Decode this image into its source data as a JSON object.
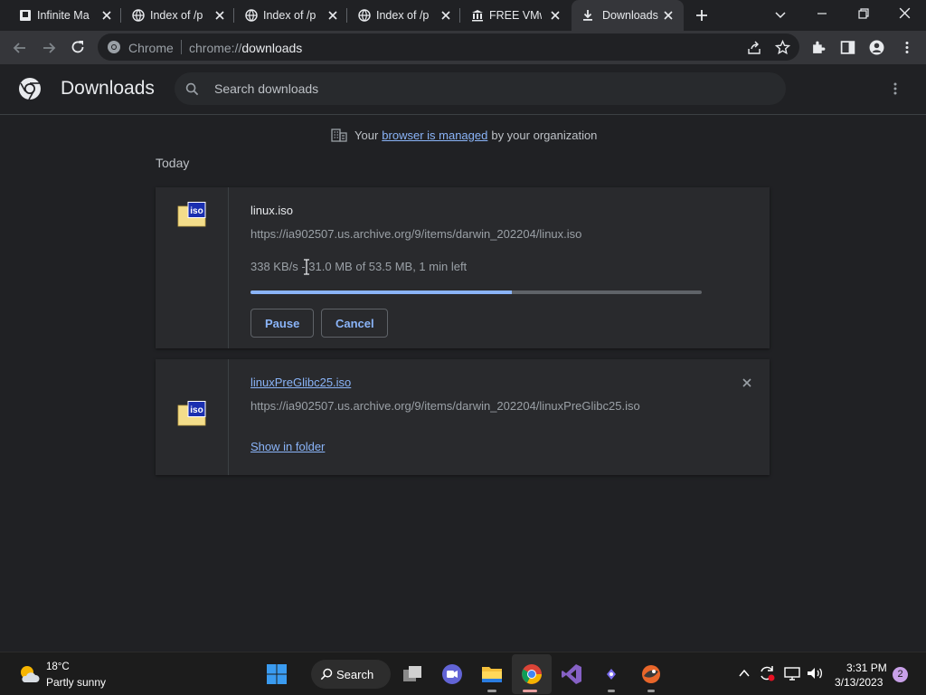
{
  "tabs": [
    {
      "title": "Infinite Mac",
      "favicon": "document-icon"
    },
    {
      "title": "Index of /pub",
      "favicon": "globe-icon"
    },
    {
      "title": "Index of /pub",
      "favicon": "globe-icon"
    },
    {
      "title": "Index of /pub",
      "favicon": "globe-icon"
    },
    {
      "title": "FREE VMware",
      "favicon": "archive-icon"
    },
    {
      "title": "Downloads",
      "favicon": "download-icon"
    }
  ],
  "omnibox": {
    "chip": "Chrome",
    "url_prefix": "chrome://",
    "url_path": "downloads"
  },
  "header": {
    "title": "Downloads",
    "search_placeholder": "Search downloads"
  },
  "managed": {
    "before": "Your",
    "link": "browser is managed",
    "after": "by your organization"
  },
  "section_label": "Today",
  "downloads": [
    {
      "filename": "linux.iso",
      "url": "https://ia902507.us.archive.org/9/items/darwin_202204/linux.iso",
      "status": "338 KB/s - 31.0 MB of 53.5 MB, 1 min left",
      "progress": 0.58,
      "pause_label": "Pause",
      "cancel_label": "Cancel"
    },
    {
      "filename": "linuxPreGlibc25.iso",
      "url": "https://ia902507.us.archive.org/9/items/darwin_202204/linuxPreGlibc25.iso",
      "action_label": "Show in folder"
    }
  ],
  "file_icon_text": "iso",
  "taskbar": {
    "weather_temp": "18°C",
    "weather_desc": "Partly sunny",
    "search_label": "Search",
    "time": "3:31 PM",
    "date": "3/13/2023",
    "notification_count": "2"
  },
  "colors": {
    "accent": "#8ab4f8",
    "background": "#202124",
    "card": "#292a2d"
  }
}
